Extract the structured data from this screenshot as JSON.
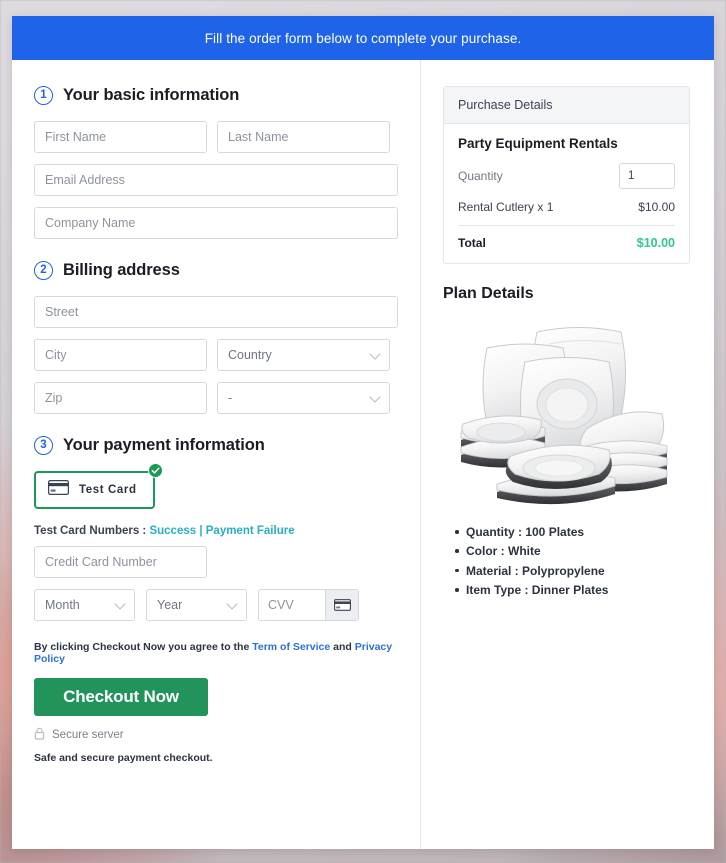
{
  "banner": {
    "text": "Fill the order form below to complete your purchase."
  },
  "sections": {
    "basic": {
      "step": "1",
      "title": "Your basic information",
      "first_name_placeholder": "First Name",
      "last_name_placeholder": "Last Name",
      "email_placeholder": "Email Address",
      "company_placeholder": "Company Name"
    },
    "billing": {
      "step": "2",
      "title": "Billing address",
      "street_placeholder": "Street",
      "city_placeholder": "City",
      "country_value": "Country",
      "zip_placeholder": "Zip",
      "state_value": "-"
    },
    "payment": {
      "step": "3",
      "title": "Your payment information",
      "test_card_label": "Test Card",
      "test_numbers_prefix": "Test Card Numbers : ",
      "test_numbers_success": "Success",
      "test_numbers_separator": " | ",
      "test_numbers_failure": "Payment Failure",
      "card_number_placeholder": "Credit Card Number",
      "month_value": "Month",
      "year_value": "Year",
      "cvv_placeholder": "CVV",
      "terms_prefix": "By clicking Checkout Now you agree to the ",
      "terms_link_1": "Term of Service",
      "terms_conjunction": " and ",
      "terms_link_2": "Privacy Policy",
      "checkout_label": "Checkout Now",
      "secure_server_label": "Secure server",
      "footnote": "Safe and secure payment checkout."
    }
  },
  "purchase_details": {
    "panel_title": "Purchase Details",
    "plan_name": "Party Equipment Rentals",
    "quantity_label": "Quantity",
    "quantity_value": "1",
    "line_item_label": "Rental Cutlery x 1",
    "line_item_value": "$10.00",
    "total_label": "Total",
    "total_value": "$10.00"
  },
  "plan_details": {
    "title": "Plan Details",
    "specs": [
      "Quantity : 100 Plates",
      "Color : White",
      "Material : Polypropylene",
      "Item Type : Dinner Plates"
    ]
  },
  "colors": {
    "banner_blue": "#1f63e8",
    "accent_blue": "#2b6fe0",
    "checkout_green": "#22945b",
    "total_green": "#2dc98a",
    "link_teal": "#27b0c4",
    "card_border_green": "#189a55"
  }
}
